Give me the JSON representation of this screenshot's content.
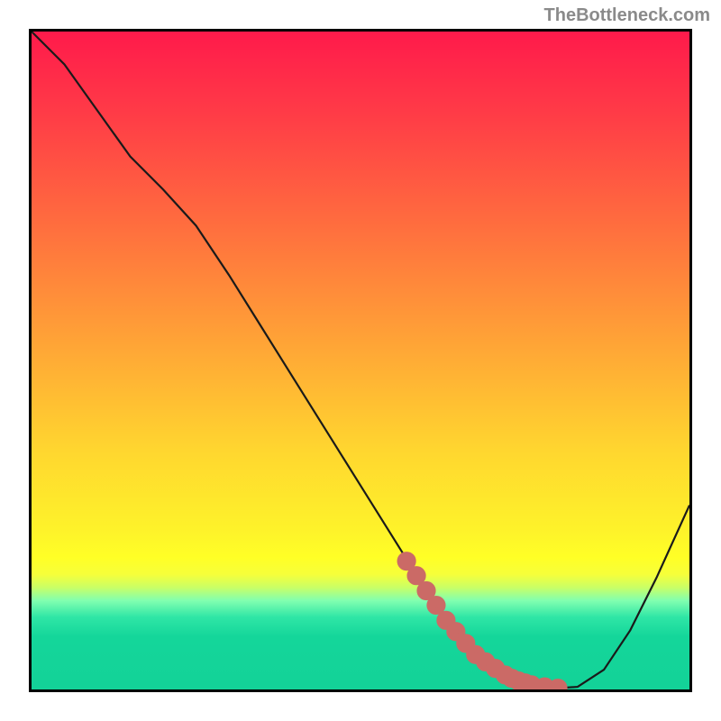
{
  "attribution": "TheBottleneck.com",
  "chart_data": {
    "type": "line",
    "title": "",
    "xlabel": "",
    "ylabel": "",
    "xlim": [
      0,
      100
    ],
    "ylim": [
      0,
      100
    ],
    "series": [
      {
        "name": "bottleneck-curve",
        "x": [
          0,
          5,
          10,
          15,
          20,
          25,
          30,
          35,
          40,
          45,
          50,
          55,
          60,
          63,
          66,
          70,
          74,
          78,
          80,
          83,
          87,
          91,
          95,
          100
        ],
        "y": [
          100,
          95,
          88,
          81,
          76,
          70.5,
          63,
          55,
          47,
          39,
          31,
          23,
          15,
          10.5,
          7,
          3.5,
          1.3,
          0.4,
          0.2,
          0.4,
          3,
          9,
          17,
          28
        ]
      }
    ],
    "dots": {
      "name": "highlight-dots",
      "x": [
        57,
        58.5,
        60,
        61.5,
        63,
        64.5,
        66,
        67.5,
        69,
        70.5,
        72,
        73,
        74,
        75,
        76,
        78,
        80
      ],
      "y": [
        19.5,
        17.3,
        15,
        12.8,
        10.5,
        8.8,
        7,
        5.3,
        4.2,
        3.2,
        2.2,
        1.7,
        1.3,
        1.0,
        0.7,
        0.4,
        0.2
      ]
    }
  },
  "colors": {
    "gradient_top": "#ff1a4b",
    "gradient_bottom": "#13d298",
    "curve": "#1a1a1a",
    "dot": "#cb6a66"
  }
}
